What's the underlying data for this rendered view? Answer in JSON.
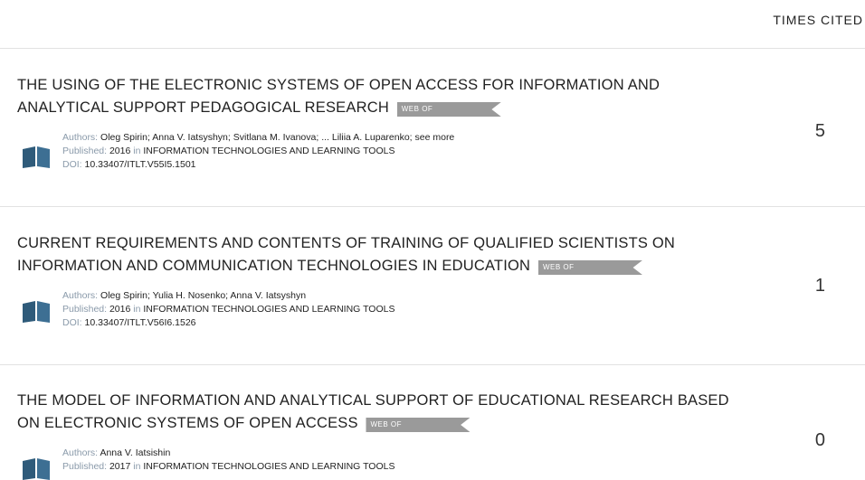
{
  "header": {
    "times_cited_label": "TIMES CITED"
  },
  "badge_label": "WEB OF",
  "records": [
    {
      "title": "THE USING OF THE ELECTRONIC SYSTEMS OF OPEN ACCESS FOR INFORMATION AND ANALYTICAL SUPPORT PEDAGOGICAL RESEARCH",
      "authors_label": "Authors:",
      "authors": "Oleg Spirin; Anna V. Iatsyshyn; Svitlana M. Ivanova; ... Liliia A. Luparenko; see more",
      "published_label": "Published:",
      "year": "2016",
      "in_label": "in",
      "journal": "INFORMATION TECHNOLOGIES AND LEARNING TOOLS",
      "doi_label": "DOI:",
      "doi": "10.33407/ITLT.V55I5.1501",
      "times_cited": "5"
    },
    {
      "title": "CURRENT REQUIREMENTS AND CONTENTS OF TRAINING OF QUALIFIED SCIENTISTS ON INFORMATION AND COMMUNICATION TECHNOLOGIES IN EDUCATION",
      "authors_label": "Authors:",
      "authors": "Oleg Spirin; Yulia H. Nosenko; Anna V. Iatsyshyn",
      "published_label": "Published:",
      "year": "2016",
      "in_label": "in",
      "journal": "INFORMATION TECHNOLOGIES AND LEARNING TOOLS",
      "doi_label": "DOI:",
      "doi": "10.33407/ITLT.V56I6.1526",
      "times_cited": "1"
    },
    {
      "title": "THE MODEL OF INFORMATION AND ANALYTICAL SUPPORT OF EDUCATIONAL RESEARCH BASED ON ELECTRONIC SYSTEMS OF OPEN ACCESS",
      "authors_label": "Authors:",
      "authors": "Anna V. Iatsishin",
      "published_label": "Published:",
      "year": "2017",
      "in_label": "in",
      "journal": "INFORMATION TECHNOLOGIES AND LEARNING TOOLS",
      "times_cited": "0"
    }
  ],
  "colors": {
    "badge": "#9a9a9a",
    "icon": "#2f5b7a",
    "meta_label": "#8a9aaa",
    "divider": "#e2e2e2"
  }
}
